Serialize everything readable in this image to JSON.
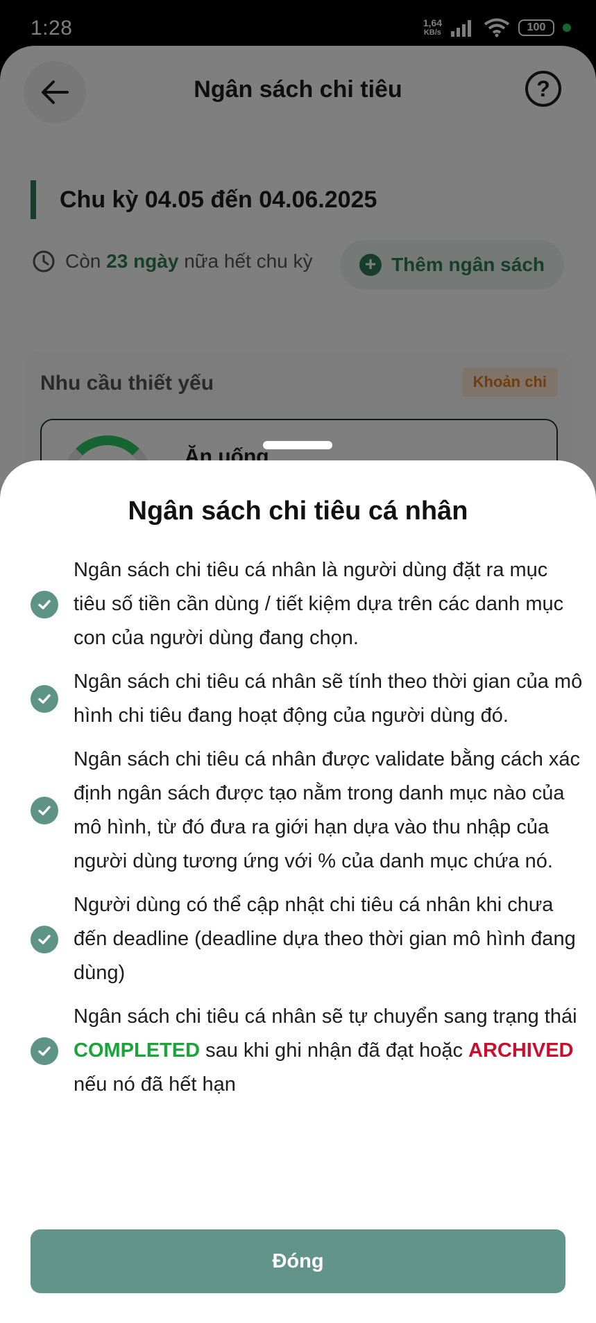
{
  "status_bar": {
    "time": "1:28",
    "net_speed_value": "1,64",
    "net_speed_unit": "KB/s",
    "battery": "100"
  },
  "background_screen": {
    "header_title": "Ngân sách chi tiêu",
    "help_label": "?",
    "cycle_title": "Chu kỳ 04.05 đến 04.06.2025",
    "remaining_prefix": "Còn ",
    "remaining_days": "23 ngày",
    "remaining_suffix": " nữa hết chu kỳ",
    "add_budget_label": "Thêm ngân sách",
    "category_title": "Nhu cầu thiết yếu",
    "category_badge": "Khoản chi",
    "item_name": "Ăn uống"
  },
  "sheet": {
    "title": "Ngân sách chi tiêu cá nhân",
    "rules": [
      {
        "text": "Ngân sách chi tiêu cá nhân là người dùng đặt ra mục tiêu số tiền cần dùng / tiết kiệm dựa trên các danh mục con của người dùng đang chọn."
      },
      {
        "text": "Ngân sách chi tiêu cá nhân sẽ tính theo thời gian của mô hình chi tiêu đang hoạt động của người dùng đó."
      },
      {
        "text": "Ngân sách chi tiêu cá nhân được validate bằng cách xác định ngân sách được tạo nằm trong danh mục nào của mô hình, từ đó đưa ra giới hạn dựa vào thu nhập của người dùng tương ứng với % của danh mục chứa nó."
      },
      {
        "text": "Người dùng có thể cập nhật chi tiêu cá nhân khi chưa đến deadline (deadline dựa theo thời gian mô hình đang dùng)"
      },
      {
        "text_before": "Ngân sách chi tiêu cá nhân sẽ tự chuyển sang trạng thái ",
        "status_completed": "COMPLETED",
        "text_middle": " sau khi ghi nhận đã đạt hoặc ",
        "status_archived": "ARCHIVED",
        "text_after": " nếu nó đã hết hạn"
      }
    ],
    "close_label": "Đóng"
  },
  "colors": {
    "brand_green": "#2e7d5b",
    "check_icon": "#5e9483",
    "close_button": "#62948a",
    "completed": "#1aa53a",
    "archived": "#c8102e"
  }
}
